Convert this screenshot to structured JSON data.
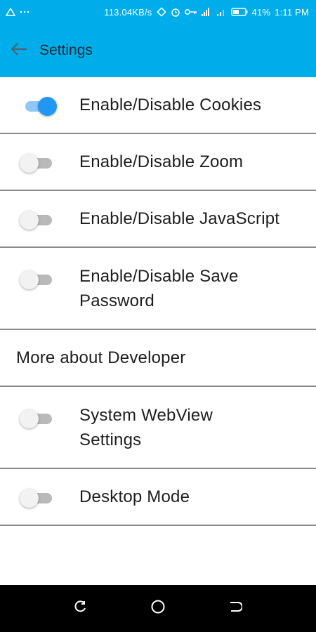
{
  "status_bar": {
    "network_speed": "113.04KB/s",
    "battery": "41%",
    "time": "1:11 PM"
  },
  "app_bar": {
    "title": "Settings"
  },
  "settings": {
    "cookies": {
      "label": "Enable/Disable Cookies",
      "enabled": true
    },
    "zoom": {
      "label": "Enable/Disable Zoom",
      "enabled": false
    },
    "javascript": {
      "label": "Enable/Disable JavaScript",
      "enabled": false
    },
    "save_password": {
      "label_line1": "Enable/Disable Save",
      "label_line2": "Password",
      "enabled": false
    },
    "developer": {
      "label": "More about Developer"
    },
    "webview": {
      "label_line1": "System WebView",
      "label_line2": "Settings",
      "enabled": false
    },
    "desktop": {
      "label": "Desktop Mode",
      "enabled": false
    }
  },
  "colors": {
    "app_bar": "#00adeb",
    "switch_on": "#2196f3",
    "switch_off": "#b9b9b9"
  },
  "icons": {
    "back": "arrow-left-icon",
    "recent": "recent-apps-icon",
    "home": "home-icon",
    "nav_back": "back-icon"
  }
}
